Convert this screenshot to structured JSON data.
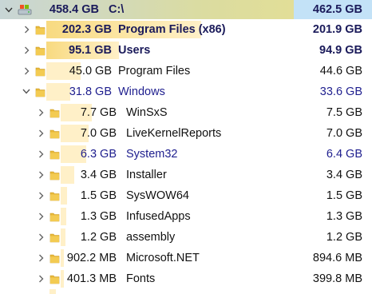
{
  "colors": {
    "folder": "#e8b93a",
    "bar": "#fff0c8",
    "bar_strong": "#f8da80",
    "selected_cell": "#c3e2f7",
    "blue_text": "#1e1e8e"
  },
  "root": {
    "size": "458.4 GB",
    "name": "C:\\",
    "allocated": "462.5 GB",
    "expanded": true,
    "icon": "drive-icon"
  },
  "items": [
    {
      "size": "202.3 GB",
      "name": "Program Files (x86)",
      "allocated": "201.9 GB",
      "level": 1,
      "expanded": false,
      "style": "bold-blue",
      "fraction": 0.441
    },
    {
      "size": "95.1 GB",
      "name": "Users",
      "allocated": "94.9 GB",
      "level": 1,
      "expanded": false,
      "style": "bold-blue",
      "fraction": 0.207
    },
    {
      "size": "45.0 GB",
      "name": "Program Files",
      "allocated": "44.6 GB",
      "level": 1,
      "expanded": false,
      "style": "normal",
      "fraction": 0.098
    },
    {
      "size": "31.8 GB",
      "name": "Windows",
      "allocated": "33.6 GB",
      "level": 1,
      "expanded": true,
      "style": "blue",
      "fraction": 0.069
    },
    {
      "size": "7.7 GB",
      "name": "WinSxS",
      "allocated": "7.5 GB",
      "level": 2,
      "expanded": false,
      "style": "normal",
      "fraction": 0.242
    },
    {
      "size": "7.0 GB",
      "name": "LiveKernelReports",
      "allocated": "7.0 GB",
      "level": 2,
      "expanded": false,
      "style": "normal",
      "fraction": 0.22
    },
    {
      "size": "6.3 GB",
      "name": "System32",
      "allocated": "6.4 GB",
      "level": 2,
      "expanded": false,
      "style": "blue",
      "fraction": 0.198
    },
    {
      "size": "3.4 GB",
      "name": "Installer",
      "allocated": "3.4 GB",
      "level": 2,
      "expanded": false,
      "style": "normal",
      "fraction": 0.107
    },
    {
      "size": "1.5 GB",
      "name": "SysWOW64",
      "allocated": "1.5 GB",
      "level": 2,
      "expanded": false,
      "style": "normal",
      "fraction": 0.047
    },
    {
      "size": "1.3 GB",
      "name": "InfusedApps",
      "allocated": "1.3 GB",
      "level": 2,
      "expanded": false,
      "style": "normal",
      "fraction": 0.041
    },
    {
      "size": "1.2 GB",
      "name": "assembly",
      "allocated": "1.2 GB",
      "level": 2,
      "expanded": false,
      "style": "normal",
      "fraction": 0.038
    },
    {
      "size": "902.2 MB",
      "name": "Microsoft.NET",
      "allocated": "894.6 MB",
      "level": 2,
      "expanded": false,
      "style": "normal",
      "fraction": 0.028
    },
    {
      "size": "401.3 MB",
      "name": "Fonts",
      "allocated": "399.8 MB",
      "level": 2,
      "expanded": false,
      "style": "normal",
      "fraction": 0.012
    }
  ]
}
